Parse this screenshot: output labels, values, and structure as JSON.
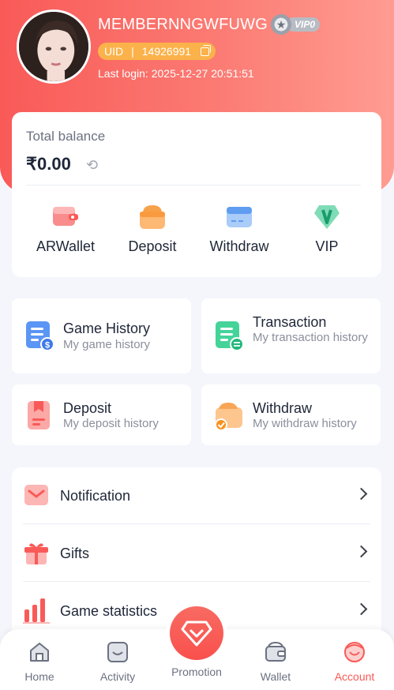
{
  "profile": {
    "username": "MEMBERNNGWFUWG",
    "vip_badge": "VIP0",
    "uid_label": "UID",
    "uid_sep": "|",
    "uid_value": "14926991",
    "last_login": "Last login: 2025-12-27 20:51:51"
  },
  "balance": {
    "label": "Total balance",
    "value": "₹0.00"
  },
  "quick_actions": [
    {
      "label": "ARWallet",
      "icon": "wallet-icon"
    },
    {
      "label": "Deposit",
      "icon": "deposit-icon"
    },
    {
      "label": "Withdraw",
      "icon": "card-icon"
    },
    {
      "label": "VIP",
      "icon": "vip-shield-icon"
    }
  ],
  "history": [
    {
      "title": "Game History",
      "subtitle": "My game history",
      "icon": "game-history-icon"
    },
    {
      "title": "Transaction",
      "subtitle": "My transaction history",
      "icon": "transaction-icon"
    },
    {
      "title": "Deposit",
      "subtitle": "My deposit history",
      "icon": "deposit-history-icon"
    },
    {
      "title": "Withdraw",
      "subtitle": "My withdraw history",
      "icon": "withdraw-history-icon"
    }
  ],
  "menu": [
    {
      "label": "Notification",
      "icon": "mail-icon"
    },
    {
      "label": "Gifts",
      "icon": "gift-icon"
    },
    {
      "label": "Game statistics",
      "icon": "bar-chart-icon"
    }
  ],
  "tabbar": [
    {
      "label": "Home",
      "icon": "home-icon"
    },
    {
      "label": "Activity",
      "icon": "activity-icon"
    },
    {
      "label": "Promotion",
      "icon": "diamond-icon"
    },
    {
      "label": "Wallet",
      "icon": "wallet-icon"
    },
    {
      "label": "Account",
      "icon": "account-icon",
      "active": true
    }
  ],
  "colors": {
    "accent": "#f95a58",
    "header_gradient_end": "#ff9c92",
    "uid_pill": "#fbb24a"
  }
}
